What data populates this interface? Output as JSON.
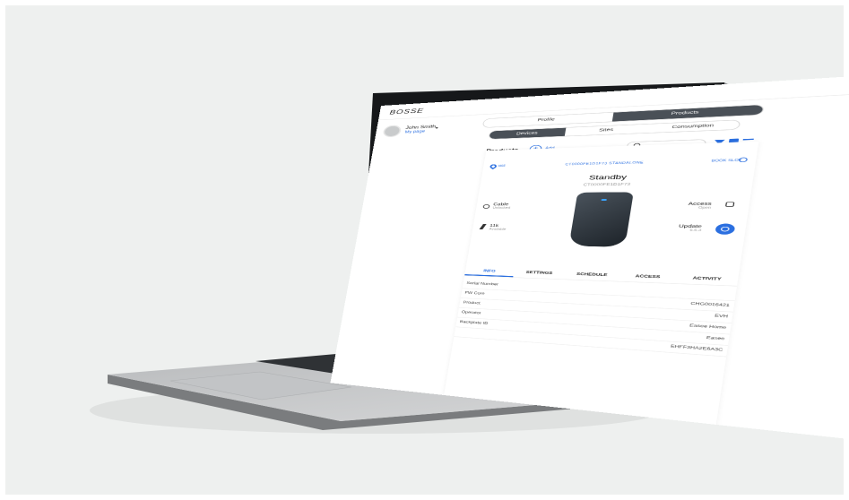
{
  "app": {
    "brand": "BOSSE"
  },
  "user": {
    "name": "John Smith",
    "link": "My page"
  },
  "nav": {
    "tabs": [
      "Profile",
      "Products"
    ],
    "active_tab": "Products"
  },
  "subnav": {
    "tabs": [
      "Devices",
      "Sites",
      "Consumption"
    ],
    "active_tab": "Devices"
  },
  "products": {
    "title": "Products",
    "add_label": "Add",
    "wifi_label": "Wifi",
    "serial_link": "CT0000FE1D1F73 STANDALONE",
    "load_link": "BOOK SLOT",
    "status": "Standby",
    "status_sub": "CT0000FE1D1F73",
    "features": {
      "cable": {
        "label": "Cable",
        "sub": "Unlocked"
      },
      "kw": {
        "label": "11k",
        "sub": "Available"
      },
      "access": {
        "label": "Access",
        "sub": "Open"
      },
      "update": {
        "label": "Update",
        "sub": "5.6.3"
      }
    },
    "tabs": [
      "INFO",
      "SETTINGS",
      "SCHEDULE",
      "ACCESS",
      "ACTIVITY"
    ],
    "active_tab": "INFO",
    "info_rows": [
      {
        "key": "Serial Number",
        "value": ""
      },
      {
        "key": "FW Core",
        "value": "CHG0016421"
      },
      {
        "key": "Product",
        "value": "EVH"
      },
      {
        "key": "Operator",
        "value": "Easee Home"
      },
      {
        "key": "Backplate ID",
        "value": "Easee"
      },
      {
        "key": "",
        "value": "EHFF3HA2E6A3C"
      }
    ]
  },
  "colors": {
    "accent": "#2b6fe0",
    "dark_segment": "#4a5057",
    "background": "#eef0ef"
  }
}
